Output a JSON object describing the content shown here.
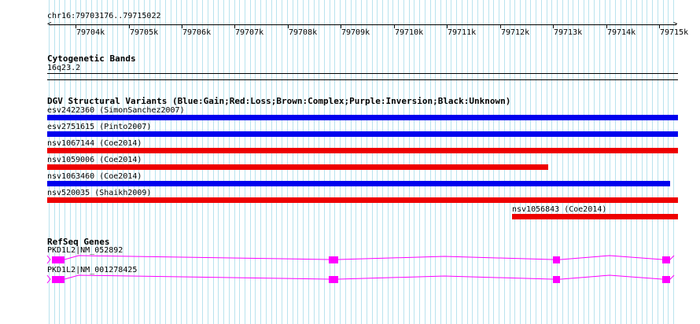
{
  "region": "chr16:79703176..79715022",
  "ruler": {
    "ticks": [
      "79704k",
      "79705k",
      "79706k",
      "79707k",
      "79708k",
      "79709k",
      "79710k",
      "79711k",
      "79712k",
      "79713k",
      "79714k",
      "79715k"
    ]
  },
  "cytoband": {
    "title": "Cytogenetic Bands",
    "band": "16q23.2"
  },
  "dgv": {
    "title": "DGV Structural Variants (Blue:Gain;Red:Loss;Brown:Complex;Purple:Inversion;Black:Unknown)",
    "colors": {
      "gain": "#0000ee",
      "loss": "#ee0000"
    },
    "variants": [
      {
        "label": "esv2422360 (SimonSanchez2007)",
        "type": "gain"
      },
      {
        "label": "esv2751615 (Pinto2007)",
        "type": "gain"
      },
      {
        "label": "nsv1067144 (Coe2014)",
        "type": "loss"
      },
      {
        "label": "nsv1059006 (Coe2014)",
        "type": "loss"
      },
      {
        "label": "nsv1063460 (Coe2014)",
        "type": "gain"
      },
      {
        "label": "nsv520035 (Shaikh2009)",
        "type": "loss"
      },
      {
        "label": "nsv1056843 (Coe2014)",
        "type": "loss"
      }
    ]
  },
  "refseq": {
    "title": "RefSeq Genes",
    "color": "#ff00ff",
    "transcripts": [
      {
        "label": "PKD1L2|NM_052892"
      },
      {
        "label": "PKD1L2|NM_001278425"
      }
    ]
  }
}
